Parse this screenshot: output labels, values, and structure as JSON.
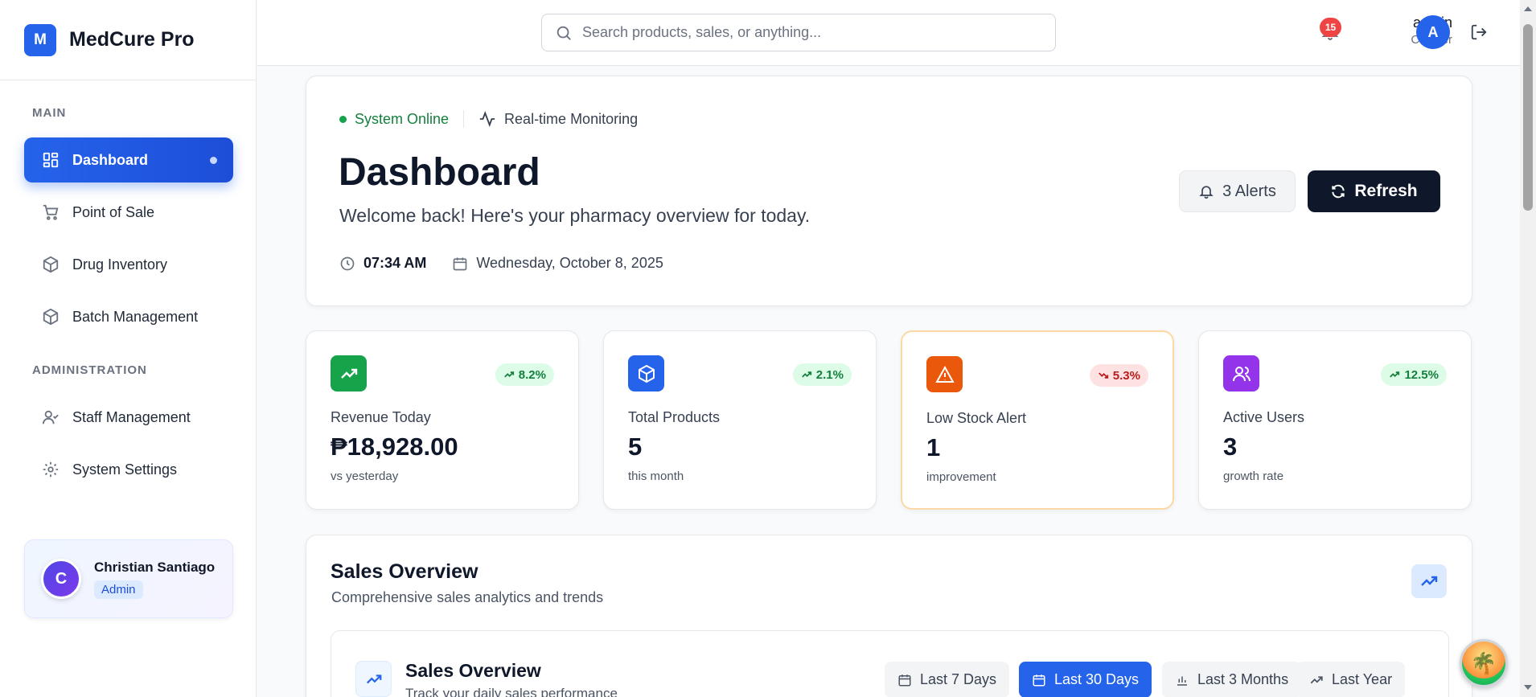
{
  "brand": {
    "logo_letter": "M",
    "name": "MedCure Pro"
  },
  "sidebar": {
    "sections": [
      {
        "label": "MAIN"
      },
      {
        "label": "ADMINISTRATION"
      }
    ],
    "items": [
      {
        "label": "Dashboard",
        "icon": "dashboard-grid-icon",
        "active": true
      },
      {
        "label": "Point of Sale",
        "icon": "cart-icon"
      },
      {
        "label": "Drug Inventory",
        "icon": "box-icon"
      },
      {
        "label": "Batch Management",
        "icon": "box-icon"
      },
      {
        "label": "Staff Management",
        "icon": "user-check-icon"
      },
      {
        "label": "System Settings",
        "icon": "gear-icon"
      }
    ],
    "profile": {
      "initial": "C",
      "name": "Christian Santiago",
      "role": "Admin"
    }
  },
  "topbar": {
    "search_placeholder": "Search products, sales, or anything...",
    "notification_count": "15",
    "user_name": "admin",
    "user_role": "Cashier",
    "user_initial": "A"
  },
  "hero": {
    "status": "System Online",
    "monitoring": "Real-time Monitoring",
    "title": "Dashboard",
    "subtitle": "Welcome back! Here's your pharmacy overview for today.",
    "time": "07:34 AM",
    "date": "Wednesday, October 8, 2025",
    "alerts_label": "3 Alerts",
    "refresh_label": "Refresh"
  },
  "stats": [
    {
      "label": "Revenue Today",
      "value": "₱18,928.00",
      "note": "vs yesterday",
      "trend": "8.2%",
      "direction": "up",
      "icon": "trending-up-icon",
      "color": "#16a34a"
    },
    {
      "label": "Total Products",
      "value": "5",
      "note": "this month",
      "trend": "2.1%",
      "direction": "up",
      "icon": "package-icon",
      "color": "#2563eb"
    },
    {
      "label": "Low Stock Alert",
      "value": "1",
      "note": "improvement",
      "trend": "5.3%",
      "direction": "down",
      "icon": "warning-icon",
      "color": "#ea580c"
    },
    {
      "label": "Active Users",
      "value": "3",
      "note": "growth rate",
      "trend": "12.5%",
      "direction": "up",
      "icon": "users-icon",
      "color": "#9333ea"
    }
  ],
  "sales": {
    "title": "Sales Overview",
    "subtitle": "Comprehensive sales analytics and trends",
    "inner_title": "Sales Overview",
    "inner_subtitle": "Track your daily sales performance",
    "ranges": [
      {
        "label": "Last 7 Days",
        "icon": "calendar-icon"
      },
      {
        "label": "Last 30 Days",
        "icon": "calendar-icon",
        "active": true
      },
      {
        "label": "Last 3 Months",
        "icon": "bar-chart-icon"
      },
      {
        "label": "Last Year",
        "icon": "trending-up-icon"
      }
    ]
  }
}
